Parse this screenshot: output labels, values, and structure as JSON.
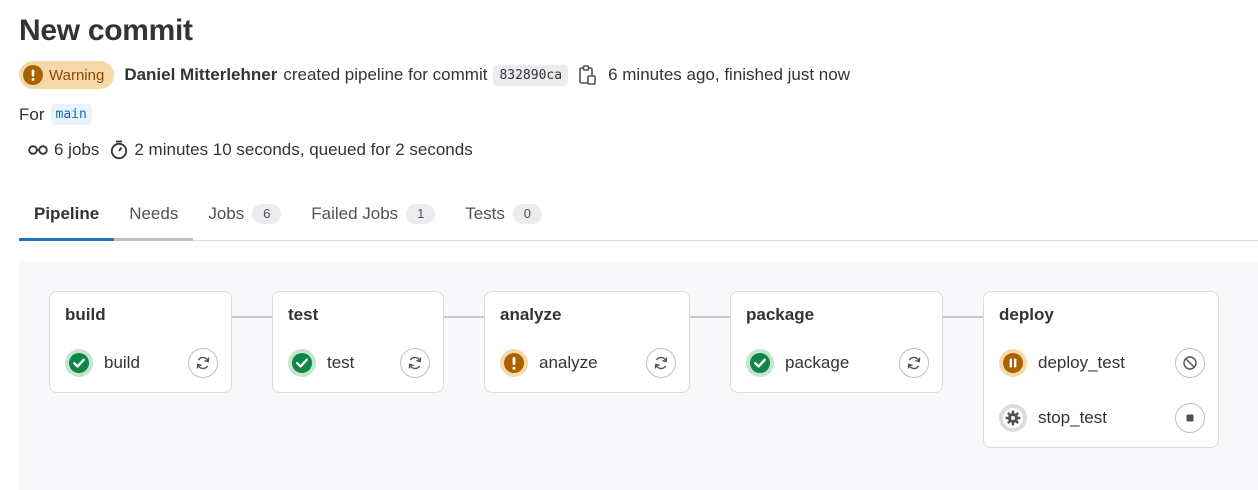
{
  "page": {
    "title": "New commit",
    "status_badge": "Warning",
    "author": "Daniel Mitterlehner",
    "created_text": "created pipeline for commit",
    "commit_sha": "832890ca",
    "time_text": "6 minutes ago, finished just now",
    "for_label": "For",
    "branch": "main",
    "jobs_count_text": "6 jobs",
    "duration_text": "2 minutes 10 seconds, queued for 2 seconds"
  },
  "tabs": [
    {
      "label": "Pipeline",
      "count": null,
      "active": true
    },
    {
      "label": "Needs",
      "count": null,
      "active": false
    },
    {
      "label": "Jobs",
      "count": "6",
      "active": false
    },
    {
      "label": "Failed Jobs",
      "count": "1",
      "active": false
    },
    {
      "label": "Tests",
      "count": "0",
      "active": false
    }
  ],
  "stages": [
    {
      "name": "build",
      "jobs": [
        {
          "name": "build",
          "status": "success-icon",
          "action": "retry-icon"
        }
      ]
    },
    {
      "name": "test",
      "jobs": [
        {
          "name": "test",
          "status": "success-icon",
          "action": "retry-icon"
        }
      ]
    },
    {
      "name": "analyze",
      "jobs": [
        {
          "name": "analyze",
          "status": "warning-icon",
          "action": "retry-icon"
        }
      ]
    },
    {
      "name": "package",
      "jobs": [
        {
          "name": "package",
          "status": "success-icon",
          "action": "retry-icon"
        }
      ]
    },
    {
      "name": "deploy",
      "jobs": [
        {
          "name": "deploy_test",
          "status": "paused-icon",
          "action": "cancel-icon"
        },
        {
          "name": "stop_test",
          "status": "manual-gear-icon",
          "action": "stop-icon"
        }
      ]
    }
  ],
  "colors": {
    "accent": "#1f75cb",
    "success": "#108548",
    "warning": "#ab6100",
    "warning_badge_bg": "#f5d9a8"
  }
}
